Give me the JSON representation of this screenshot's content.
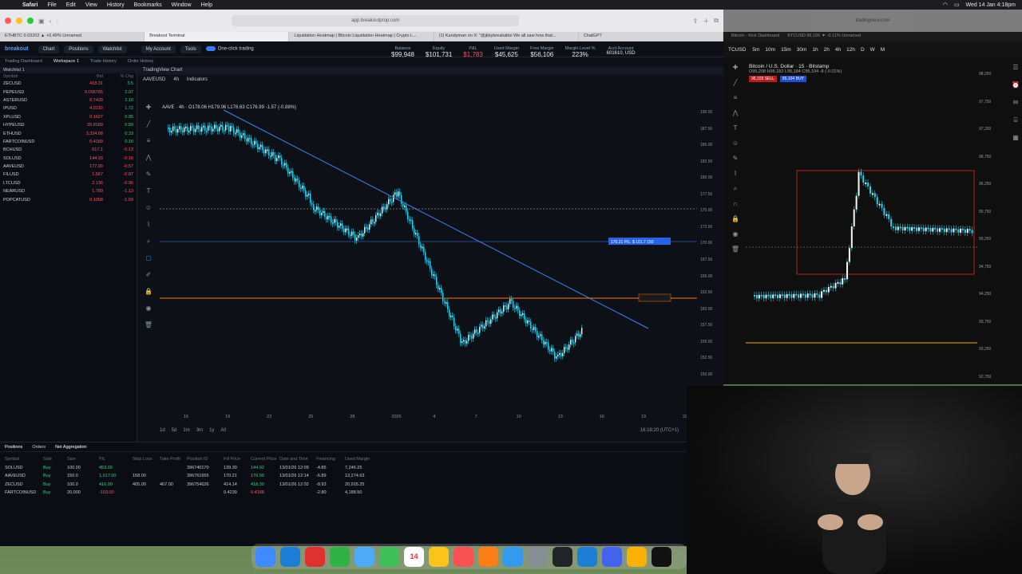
{
  "menubar": {
    "app": "Safari",
    "items": [
      "File",
      "Edit",
      "View",
      "History",
      "Bookmarks",
      "Window",
      "Help"
    ],
    "clock": "Wed 14 Jan 4:18pm"
  },
  "left_window": {
    "url": "app.breakoutprop.com",
    "tabs": [
      "ETHBTC 0.03202 ▲ +0.49% Unnamed",
      "Breakout Terminal",
      "Liquidation Heatmap | Bitcoin Liquidation Heatmap | Crypto L...",
      "(1) Kandyman on X: \"@jkbybreakable We all saw how that...",
      "ChatGPT"
    ],
    "brand": "breakout",
    "nav": [
      "Chart",
      "Positions",
      "Watchlist"
    ],
    "account_menu": "My Account",
    "tools_menu": "Tools",
    "one_click": "One-click trading",
    "subnav": [
      "Trading Dashboard",
      "Workspace 1",
      "Trade History",
      "Order History"
    ],
    "stats": [
      {
        "label": "Balance",
        "value": "$99,948",
        "color": "normal"
      },
      {
        "label": "Equity",
        "value": "$101,731",
        "color": "normal"
      },
      {
        "label": "P&L",
        "value": "$1,783",
        "color": "red"
      },
      {
        "label": "Used Margin",
        "value": "$45,625",
        "color": "normal"
      },
      {
        "label": "Free Margin",
        "value": "$56,106",
        "color": "normal"
      },
      {
        "label": "Margin Level %",
        "value": "223%",
        "color": "normal"
      },
      {
        "label": "Acct Account",
        "value": "601610, USD",
        "color": "normal"
      }
    ],
    "watchlist": {
      "title": "Watchlist 1",
      "columns": [
        "Symbol",
        "Bid",
        "% Chg"
      ],
      "rows": [
        {
          "sym": "ZECUSD",
          "bid": "418.31",
          "chg": "3.5",
          "up": true
        },
        {
          "sym": "PEPEUSD",
          "bid": "0.006766",
          "chg": "2.97",
          "up": true
        },
        {
          "sym": "ASTERUSD",
          "bid": "0.7439",
          "chg": "2.10",
          "up": true
        },
        {
          "sym": "IPUSD",
          "bid": "4.0210",
          "chg": "1.72",
          "up": true
        },
        {
          "sym": "XPLUSD",
          "bid": "0.1627",
          "chg": "0.95",
          "up": true
        },
        {
          "sym": "HYPEUSD",
          "bid": "25.8189",
          "chg": "0.59",
          "up": true
        },
        {
          "sym": "ETHUSD",
          "bid": "3,334.68",
          "chg": "0.33",
          "up": true
        },
        {
          "sym": "FARTCOINUSD",
          "bid": "0.4189",
          "chg": "0.10",
          "up": true
        },
        {
          "sym": "BCHUSD",
          "bid": "617.1",
          "chg": "-0.13",
          "up": false
        },
        {
          "sym": "SOLUSD",
          "bid": "144.93",
          "chg": "-0.16",
          "up": false
        },
        {
          "sym": "AAVEUSD",
          "bid": "177.00",
          "chg": "-0.57",
          "up": false
        },
        {
          "sym": "FILUSD",
          "bid": "1.567",
          "chg": "-0.87",
          "up": false
        },
        {
          "sym": "LTCUSD",
          "bid": "2.136",
          "chg": "-0.95",
          "up": false
        },
        {
          "sym": "NEARUSD",
          "bid": "1.789",
          "chg": "-1.13",
          "up": false
        },
        {
          "sym": "POPCATUSD",
          "bid": "0.1058",
          "chg": "-1.59",
          "up": false
        }
      ]
    },
    "chart": {
      "window_title": "TradingView Chart",
      "symbol": "AAVEUSD",
      "interval": "4h",
      "indicators_label": "Indicators",
      "ohlc": "AAVE · 4h · O178.06 H179.06 L178.63 C176.99 -1.57 (-0.88%)",
      "price_labels": [
        "176.99",
        "170.21",
        "155.00"
      ],
      "yaxis": [
        "190.00",
        "187.50",
        "185.00",
        "182.50",
        "180.00",
        "177.50",
        "175.00",
        "172.50",
        "170.00",
        "167.50",
        "165.00",
        "162.50",
        "160.00",
        "157.50",
        "155.00",
        "152.50",
        "150.00",
        "147.50",
        "145.00"
      ],
      "xaxis": [
        "16",
        "19",
        "22",
        "25",
        "28",
        "2026",
        "4",
        "7",
        "10",
        "13",
        "16",
        "19",
        "22"
      ],
      "time": "16:18:20 (UTC+1)",
      "timeframes": [
        "1d",
        "5d",
        "1m",
        "3m",
        "1y",
        "All"
      ],
      "tp_tag": "170.21 P/L: $ 101.7 150"
    },
    "positions": {
      "tabs": [
        "Positions",
        "Orders",
        "Net Aggregation"
      ],
      "columns": [
        "Symbol",
        "Side",
        "Size",
        "P/L",
        "Stop Loss",
        "Take Profit",
        "Position ID",
        "Fill Price",
        "Current Price",
        "Date and Time",
        "Financing",
        "Used Margin"
      ],
      "rows": [
        {
          "sym": "SOLUSD",
          "side": "Buy",
          "size": "100.00",
          "pl": "453.00",
          "sl": "",
          "tp": "",
          "id": "396740170",
          "fill": "139.39",
          "cur": "144.92",
          "dt": "13/01/26 12:09",
          "fin": "-4.85",
          "margin": "7,246.25"
        },
        {
          "sym": "AAVEUSD",
          "side": "Buy",
          "size": "150.0",
          "pl": "1,017.00",
          "sl": "158.00",
          "tp": "",
          "id": "396761655",
          "fill": "170.21",
          "cur": "176.99",
          "dt": "13/01/26 12:14",
          "fin": "-6.89",
          "margin": "13,274.63"
        },
        {
          "sym": "ZECUSD",
          "side": "Buy",
          "size": "100.0",
          "pl": "416.00",
          "sl": "405.00",
          "tp": "467.00",
          "id": "396754626",
          "fill": "414.14",
          "cur": "418.30",
          "dt": "13/01/26 12:02",
          "fin": "-8.93",
          "margin": "20,915.25"
        },
        {
          "sym": "FARTCOINUSD",
          "side": "Buy",
          "size": "20,000",
          "pl": "-103.00",
          "sl": "",
          "tp": "",
          "id": "",
          "fill": "0.4239",
          "cur": "0.4188",
          "dt": "",
          "fin": "-2.80",
          "margin": "4,188.50"
        }
      ]
    }
  },
  "right_window": {
    "url": "tradingview.com",
    "tabs": [
      "Bitcoin - Kick Dashboard",
      "BTCUSD 95,156 ▼ -0.11% Unnamed"
    ],
    "symbol": "TCUSD",
    "title": "Bitcoin / U.S. Dollar · 15 · Bitstamp",
    "ohlc": "O95,208 H95,182 L95,184 C95,104 -8 (-0.01%)",
    "sell_price": "95,103",
    "sell_label": "SELL",
    "buy_price": "95,104",
    "buy_label": "BUY",
    "intervals": [
      "5m",
      "10m",
      "15m",
      "30m",
      "1h",
      "2h",
      "4h",
      "12h",
      "D",
      "W",
      "M"
    ],
    "yaxis": [
      "98,250",
      "97,750",
      "97,250",
      "96,750",
      "96,250",
      "95,750",
      "95,250",
      "94,750",
      "94,250",
      "93,750",
      "93,250",
      "92,750"
    ],
    "price_tag": "95,104",
    "level_tag": "93,650"
  },
  "dock": [
    "Finder",
    "Safari",
    "Chrome",
    "WhatsApp",
    "Mail",
    "Messages",
    "Calendar",
    "Notes",
    "Music",
    "Pages",
    "App Store",
    "Settings",
    "Stocks",
    "Telegram",
    "Zoom",
    "Notes2",
    "ChatGPT"
  ],
  "dock_calendar_date": "14",
  "colors": {
    "accent": "#3c7bff",
    "up": "#36d07a",
    "down": "#ff5566",
    "candle": "#22d3ee"
  }
}
